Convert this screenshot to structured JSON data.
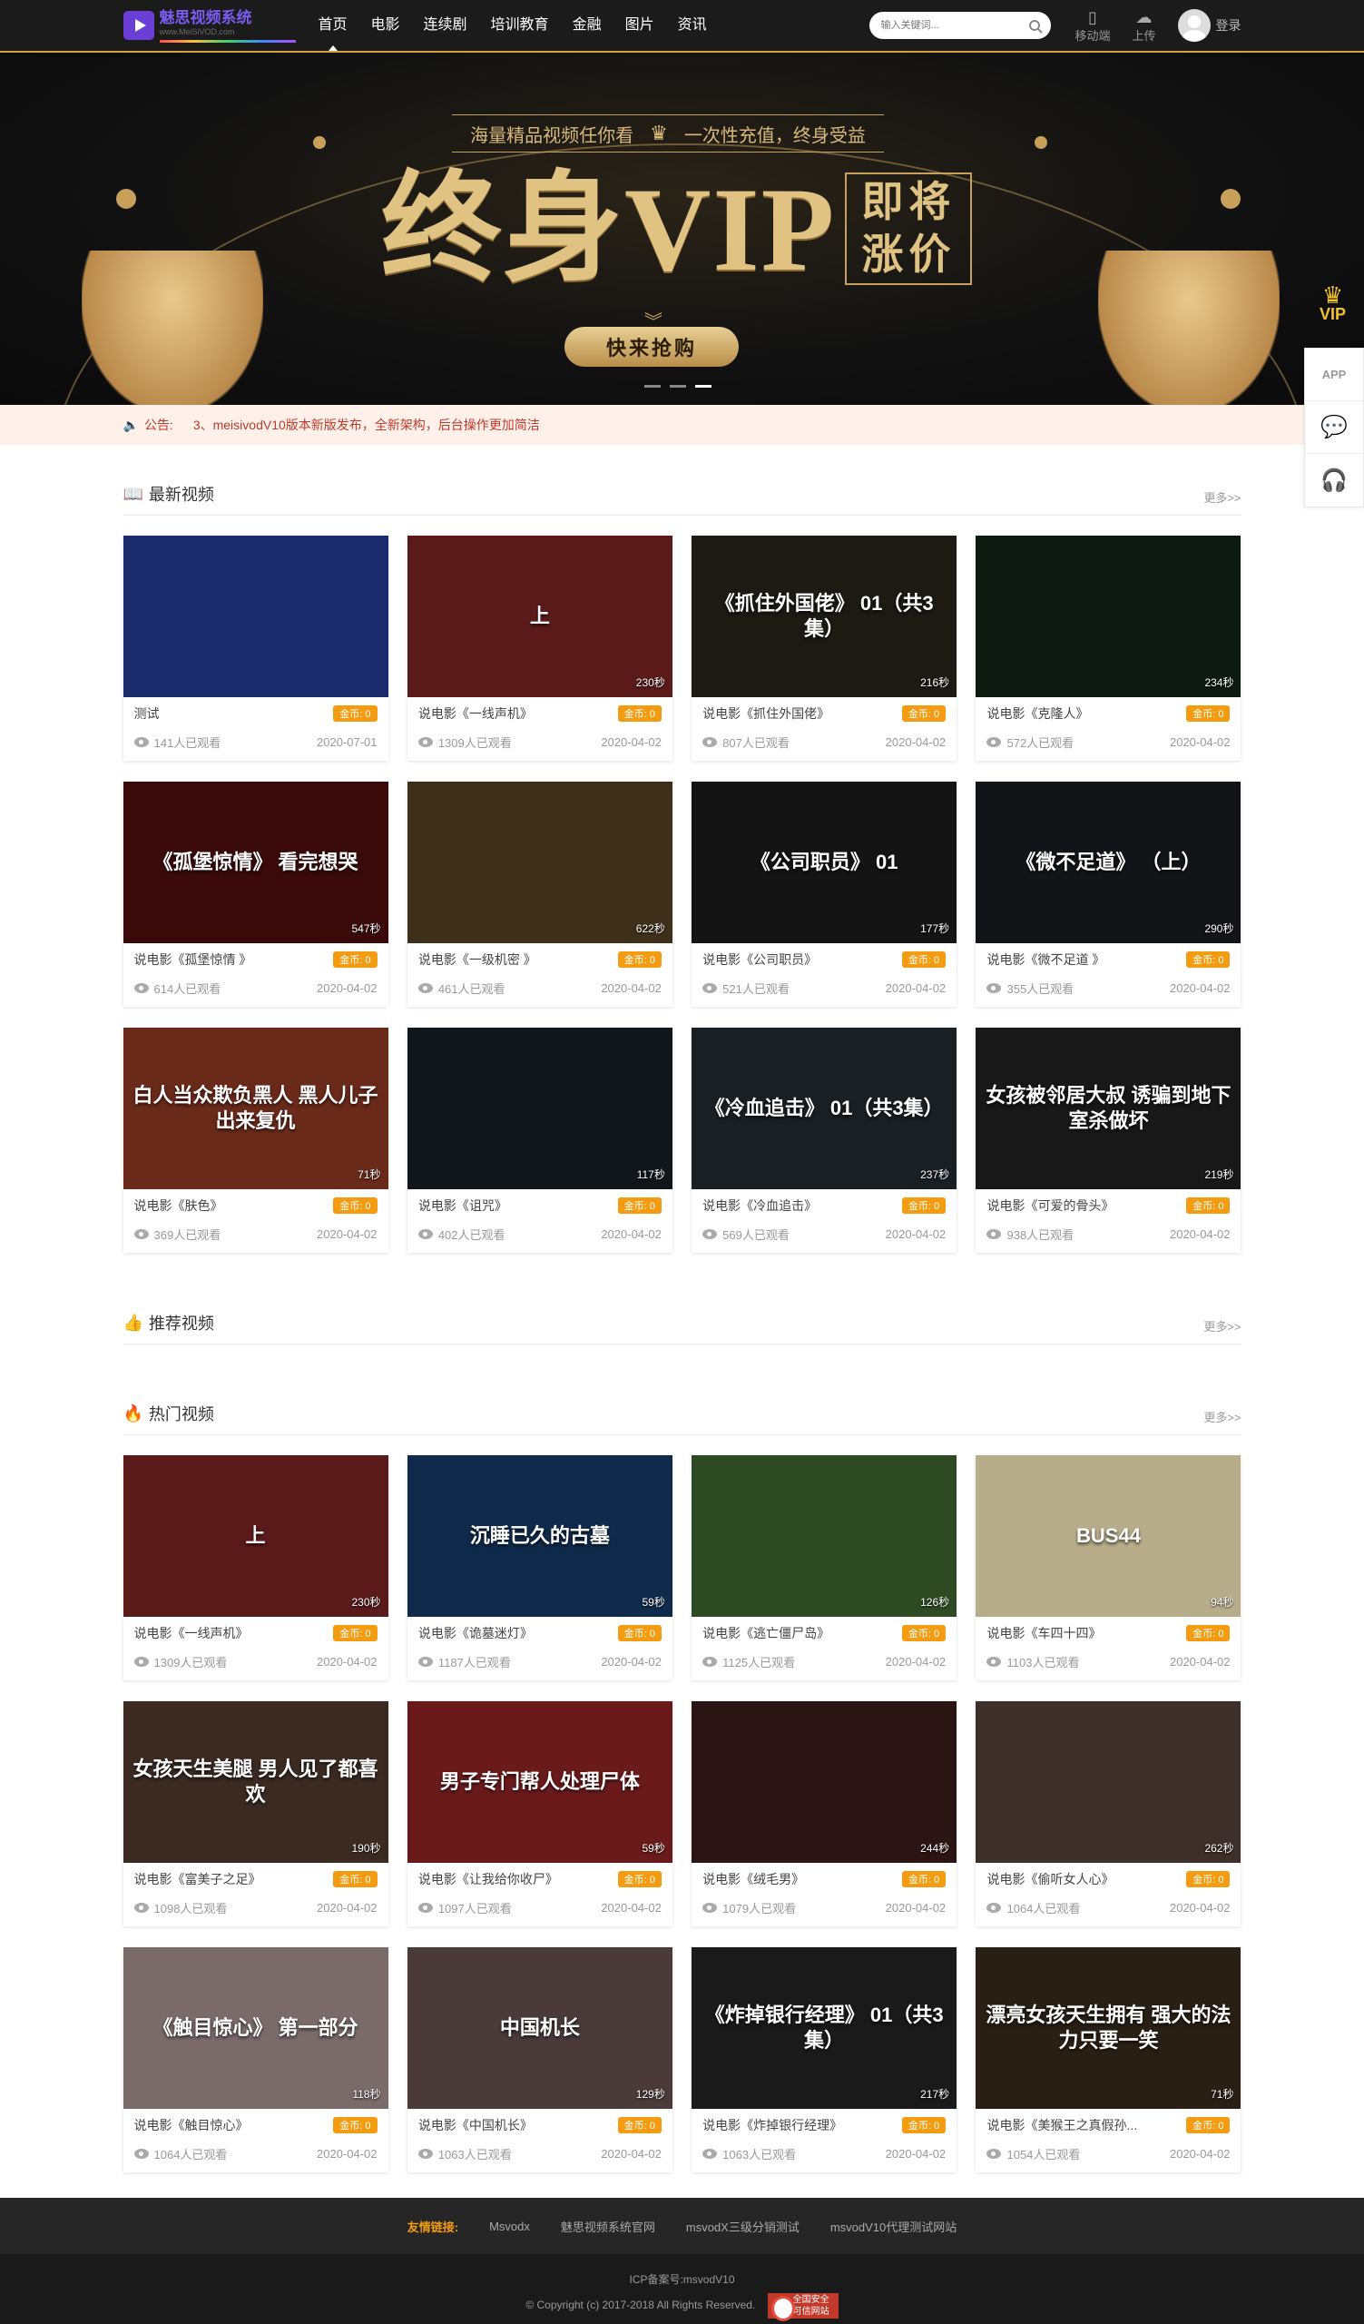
{
  "header": {
    "logo_title": "魅思视频系统",
    "logo_sub": "www.MeiSiVOD.com",
    "nav": [
      "首页",
      "电影",
      "连续剧",
      "培训教育",
      "金融",
      "图片",
      "资讯"
    ],
    "search_placeholder": "输入关键词...",
    "mobile_label": "移动端",
    "upload_label": "上传",
    "login_label": "登录"
  },
  "banner": {
    "top_left": "海量精品视频任你看",
    "top_right": "一次性充值，终身受益",
    "big_text": "终身VIP",
    "side_line1": "即将",
    "side_line2": "涨价",
    "button": "快来抢购",
    "vip_badge": "VIP"
  },
  "side_float": {
    "app": "APP",
    "chat": "💬",
    "service": "🎧"
  },
  "notice": {
    "label": "公告:",
    "text": "3、meisivodV10版本新版发布，全新架构，后台操作更加简洁"
  },
  "sections": [
    {
      "title": "最新视频",
      "more": "更多>>",
      "videos": [
        {
          "title": "测试",
          "gold": "金币: 0",
          "views": "141人已观看",
          "date": "2020-07-01",
          "duration": "",
          "thumb_text": "",
          "bg": "#1b2a6b"
        },
        {
          "title": "说电影《一线声机》",
          "gold": "金币: 0",
          "views": "1309人已观看",
          "date": "2020-04-02",
          "duration": "230秒",
          "thumb_text": "上",
          "bg": "#5a1a1a"
        },
        {
          "title": "说电影《抓住外国佬》",
          "gold": "金币: 0",
          "views": "807人已观看",
          "date": "2020-04-02",
          "duration": "216秒",
          "thumb_text": "《抓住外国佬》 01（共3集）",
          "bg": "#1d1a14"
        },
        {
          "title": "说电影《克隆人》",
          "gold": "金币: 0",
          "views": "572人已观看",
          "date": "2020-04-02",
          "duration": "234秒",
          "thumb_text": "",
          "bg": "#0d1a12"
        },
        {
          "title": "说电影《孤堡惊情 》",
          "gold": "金币: 0",
          "views": "614人已观看",
          "date": "2020-04-02",
          "duration": "547秒",
          "thumb_text": "《孤堡惊情》 看完想哭",
          "bg": "#3a0a0a"
        },
        {
          "title": "说电影《一级机密 》",
          "gold": "金币: 0",
          "views": "461人已观看",
          "date": "2020-04-02",
          "duration": "622秒",
          "thumb_text": "",
          "bg": "#3e2f1a"
        },
        {
          "title": "说电影《公司职员》",
          "gold": "金币: 0",
          "views": "521人已观看",
          "date": "2020-04-02",
          "duration": "177秒",
          "thumb_text": "《公司职员》 01",
          "bg": "#141414"
        },
        {
          "title": "说电影《微不足道 》",
          "gold": "金币: 0",
          "views": "355人已观看",
          "date": "2020-04-02",
          "duration": "290秒",
          "thumb_text": "《微不足道》 （上）",
          "bg": "#121418"
        },
        {
          "title": "说电影《肤色》",
          "gold": "金币: 0",
          "views": "369人已观看",
          "date": "2020-04-02",
          "duration": "71秒",
          "thumb_text": "白人当众欺负黑人 黑人儿子出来复仇",
          "bg": "#6a2a1a"
        },
        {
          "title": "说电影《诅咒》",
          "gold": "金币: 0",
          "views": "402人已观看",
          "date": "2020-04-02",
          "duration": "117秒",
          "thumb_text": "",
          "bg": "#10161a"
        },
        {
          "title": "说电影《冷血追击》",
          "gold": "金币: 0",
          "views": "569人已观看",
          "date": "2020-04-02",
          "duration": "237秒",
          "thumb_text": "《冷血追击》 01（共3集）",
          "bg": "#1a1f24"
        },
        {
          "title": "说电影《可爱的骨头》",
          "gold": "金币: 0",
          "views": "938人已观看",
          "date": "2020-04-02",
          "duration": "219秒",
          "thumb_text": "女孩被邻居大叔 诱骗到地下室杀做坏",
          "bg": "#181818"
        }
      ]
    },
    {
      "title": "推荐视频",
      "more": "更多>>",
      "videos": []
    },
    {
      "title": "热门视频",
      "more": "更多>>",
      "videos": [
        {
          "title": "说电影《一线声机》",
          "gold": "金币: 0",
          "views": "1309人已观看",
          "date": "2020-04-02",
          "duration": "230秒",
          "thumb_text": "上",
          "bg": "#5a1a1a"
        },
        {
          "title": "说电影《诡墓迷灯》",
          "gold": "金币: 0",
          "views": "1187人已观看",
          "date": "2020-04-02",
          "duration": "59秒",
          "thumb_text": "沉睡已久的古墓",
          "bg": "#0f2a4a"
        },
        {
          "title": "说电影《逃亡僵尸岛》",
          "gold": "金币: 0",
          "views": "1125人已观看",
          "date": "2020-04-02",
          "duration": "126秒",
          "thumb_text": "",
          "bg": "#2d4a22"
        },
        {
          "title": "说电影《车四十四》",
          "gold": "金币: 0",
          "views": "1103人已观看",
          "date": "2020-04-02",
          "duration": "94秒",
          "thumb_text": "BUS44",
          "bg": "#b8ad8a"
        },
        {
          "title": "说电影《富美子之足》",
          "gold": "金币: 0",
          "views": "1098人已观看",
          "date": "2020-04-02",
          "duration": "190秒",
          "thumb_text": "女孩天生美腿 男人见了都喜欢",
          "bg": "#3a2a22"
        },
        {
          "title": "说电影《让我给你收尸》",
          "gold": "金币: 0",
          "views": "1097人已观看",
          "date": "2020-04-02",
          "duration": "59秒",
          "thumb_text": "男子专门帮人处理尸体",
          "bg": "#6a1a1a"
        },
        {
          "title": "说电影《绒毛男》",
          "gold": "金币: 0",
          "views": "1079人已观看",
          "date": "2020-04-02",
          "duration": "244秒",
          "thumb_text": "",
          "bg": "#2a1414"
        },
        {
          "title": "说电影《偷听女人心》",
          "gold": "金币: 0",
          "views": "1064人已观看",
          "date": "2020-04-02",
          "duration": "262秒",
          "thumb_text": "",
          "bg": "#3d2f2a"
        },
        {
          "title": "说电影《触目惊心》",
          "gold": "金币: 0",
          "views": "1064人已观看",
          "date": "2020-04-02",
          "duration": "118秒",
          "thumb_text": "《触目惊心》 第一部分",
          "bg": "#7a6a6a"
        },
        {
          "title": "说电影《中国机长》",
          "gold": "金币: 0",
          "views": "1063人已观看",
          "date": "2020-04-02",
          "duration": "129秒",
          "thumb_text": "中国机长",
          "bg": "#4a3a3a"
        },
        {
          "title": "说电影《炸掉银行经理》",
          "gold": "金币: 0",
          "views": "1063人已观看",
          "date": "2020-04-02",
          "duration": "217秒",
          "thumb_text": "《炸掉银行经理》 01（共3集）",
          "bg": "#1a1a1a"
        },
        {
          "title": "说电影《美猴王之真假孙...",
          "gold": "金币: 0",
          "views": "1054人已观看",
          "date": "2020-04-02",
          "duration": "71秒",
          "thumb_text": "漂亮女孩天生拥有 强大的法力只要一笑",
          "bg": "#2a1f14"
        }
      ]
    }
  ],
  "footer": {
    "links_label": "友情链接:",
    "links": [
      "Msvodx",
      "魅思视频系统官网",
      "msvodX三级分销测试",
      "msvodV10代理测试网站"
    ],
    "icp": "ICP备案号:msvodV10",
    "copyright": "© Copyright (c) 2017-2018 All Rights Reserved.",
    "badge_line1": "全国安全",
    "badge_line2": "可信网站"
  }
}
